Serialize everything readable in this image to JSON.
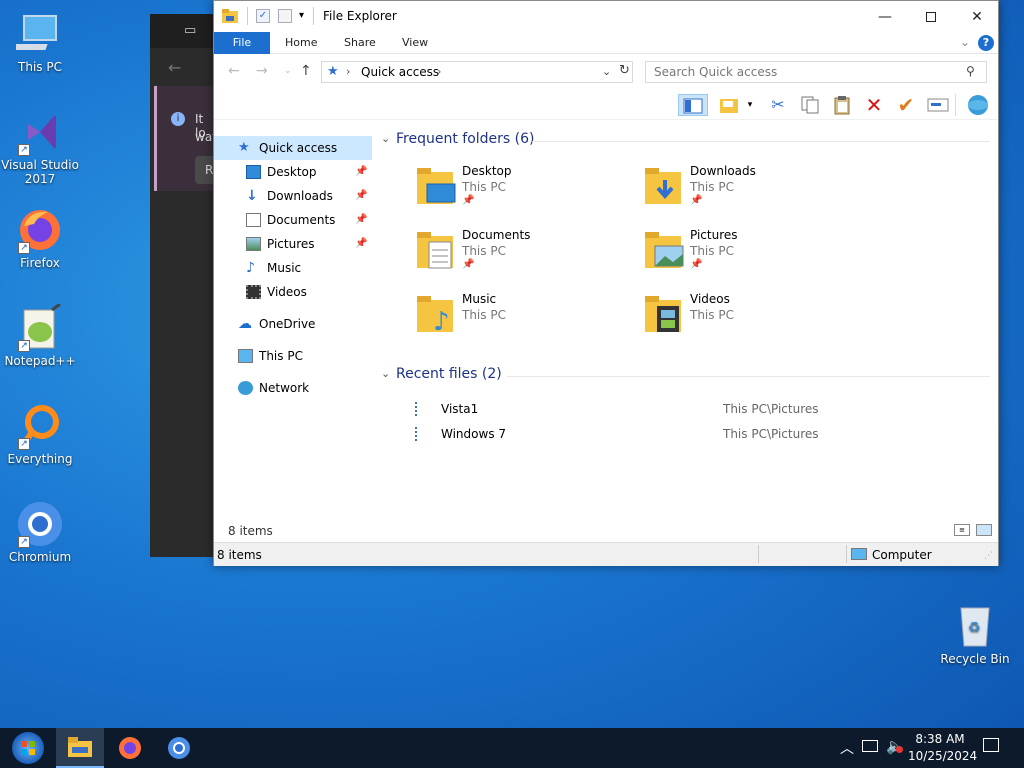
{
  "desktop": {
    "icons": [
      {
        "label": "This PC"
      },
      {
        "label": "Visual Studio 2017"
      },
      {
        "label": "Firefox"
      },
      {
        "label": "Notepad++"
      },
      {
        "label": "Everything"
      },
      {
        "label": "Chromium"
      },
      {
        "label": "Recycle Bin"
      }
    ],
    "bg_window_text": [
      "It lo",
      "way",
      "R"
    ]
  },
  "explorer": {
    "title": "File Explorer",
    "ribbon_tabs": [
      {
        "label": "File",
        "active": true
      },
      {
        "label": "Home"
      },
      {
        "label": "Share"
      },
      {
        "label": "View"
      }
    ],
    "address": {
      "path": "Quick access",
      "search_placeholder": "Search Quick access"
    },
    "nav": [
      {
        "label": "Quick access",
        "selected": true
      },
      {
        "label": "Desktop",
        "pinned": true
      },
      {
        "label": "Downloads",
        "pinned": true
      },
      {
        "label": "Documents",
        "pinned": true
      },
      {
        "label": "Pictures",
        "pinned": true
      },
      {
        "label": "Music"
      },
      {
        "label": "Videos"
      },
      {
        "label": "OneDrive"
      },
      {
        "label": "This PC"
      },
      {
        "label": "Network"
      }
    ],
    "frequent": {
      "header": "Frequent folders (6)",
      "folders": [
        {
          "name": "Desktop",
          "location": "This PC",
          "pinned": true
        },
        {
          "name": "Downloads",
          "location": "This PC",
          "pinned": true
        },
        {
          "name": "Documents",
          "location": "This PC",
          "pinned": true
        },
        {
          "name": "Pictures",
          "location": "This PC",
          "pinned": true
        },
        {
          "name": "Music",
          "location": "This PC"
        },
        {
          "name": "Videos",
          "location": "This PC"
        }
      ]
    },
    "recent": {
      "header": "Recent files (2)",
      "files": [
        {
          "name": "Vista1",
          "path": "This PC\\Pictures"
        },
        {
          "name": "Windows 7",
          "path": "This PC\\Pictures"
        }
      ]
    },
    "item_count": "8 items",
    "status": {
      "count": "8 items",
      "location": "Computer"
    }
  },
  "taskbar": {
    "time": "8:38 AM",
    "date": "10/25/2024"
  },
  "colors": {
    "accent": "#1c6ecf",
    "taskbar": "#0c1a2b",
    "desktop": "#1a76d0"
  }
}
